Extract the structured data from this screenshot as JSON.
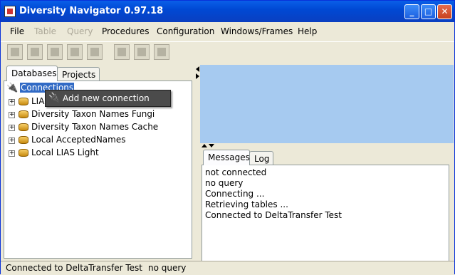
{
  "window": {
    "title": "Diversity Navigator 0.97.18"
  },
  "menu": [
    {
      "label": "File",
      "enabled": true
    },
    {
      "label": "Table",
      "enabled": false
    },
    {
      "label": "Query",
      "enabled": false
    },
    {
      "label": "Procedures",
      "enabled": true
    },
    {
      "label": "Configuration",
      "enabled": true
    },
    {
      "label": "Windows/Frames",
      "enabled": true
    },
    {
      "label": "Help",
      "enabled": true
    }
  ],
  "left_tabs": [
    {
      "label": "Databases",
      "active": true
    },
    {
      "label": "Projects",
      "active": false
    }
  ],
  "tree": {
    "root": "Connections",
    "items": [
      {
        "label": "LIAS"
      },
      {
        "label": "Diversity Taxon Names Fungi"
      },
      {
        "label": "Diversity Taxon Names Cache"
      },
      {
        "label": "Local AcceptedNames"
      },
      {
        "label": "Local LIAS Light"
      }
    ]
  },
  "context_menu": {
    "item": "Add new connection"
  },
  "right_tabs": [
    {
      "label": "Messages",
      "active": true
    },
    {
      "label": "Log",
      "active": false
    }
  ],
  "messages": [
    "not connected",
    "no query",
    "Connecting ...",
    "Retrieving tables ...",
    "Connected to DeltaTransfer Test"
  ],
  "status": {
    "connection": "Connected to DeltaTransfer Test",
    "query": "no query"
  }
}
